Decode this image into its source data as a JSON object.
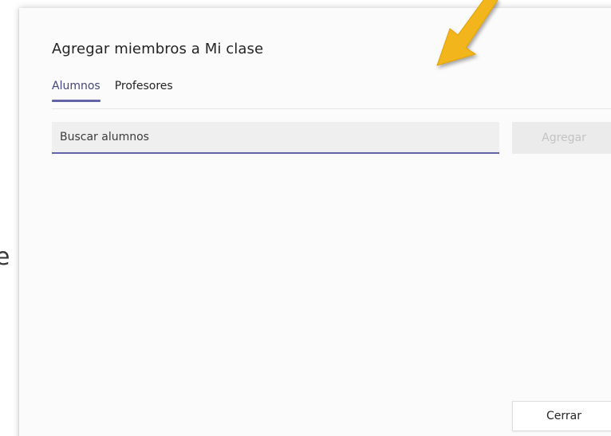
{
  "background": {
    "fragment_text": "e"
  },
  "dialog": {
    "title": "Agregar miembros a Mi clase",
    "tabs": [
      {
        "label": "Alumnos",
        "active": true
      },
      {
        "label": "Profesores",
        "active": false
      }
    ],
    "search": {
      "placeholder": "Buscar alumnos",
      "value": ""
    },
    "add_button_label": "Agregar",
    "close_button_label": "Cerrar"
  },
  "annotation": {
    "arrow_color": "#f2b51a",
    "arrow_icon": "pointer-arrow-icon"
  },
  "colors": {
    "accent": "#6264a7",
    "disabled_text": "#c3c3c3"
  }
}
